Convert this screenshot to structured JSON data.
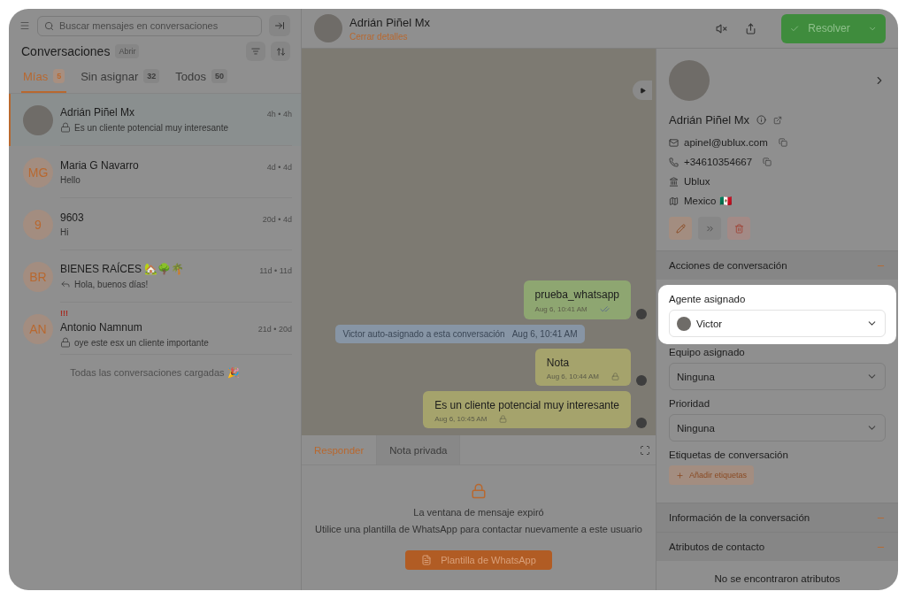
{
  "sidebar": {
    "search": {
      "placeholder": "Buscar mensajes en conversaciones"
    },
    "title": "Conversaciones",
    "status_badge": "Abrir",
    "tabs": [
      {
        "label": "Mías",
        "count": "5",
        "selected": true
      },
      {
        "label": "Sin asignar",
        "count": "32",
        "selected": false
      },
      {
        "label": "Todos",
        "count": "50",
        "selected": false
      }
    ],
    "conversations": [
      {
        "name": "Adrián Piñel Mx",
        "time": "4h • 4h",
        "preview": "Es un cliente potencial muy interesante",
        "private": true,
        "replied": false,
        "selected": true
      },
      {
        "name": "Maria G Navarro",
        "initials": "MG",
        "time": "4d • 4d",
        "preview": "Hello",
        "private": false,
        "replied": false,
        "selected": false
      },
      {
        "name": "9603",
        "initials": "9",
        "time": "20d • 4d",
        "preview": "Hi",
        "private": false,
        "replied": false,
        "selected": false
      },
      {
        "name": "BIENES RAÍCES 🏡🌳🌴",
        "initials": "BR",
        "time": "11d • 11d",
        "preview": "Hola, buenos días!",
        "private": false,
        "replied": true,
        "selected": false
      },
      {
        "name": "Antonio Namnum",
        "initials": "AN",
        "priority": "!!!",
        "time": "21d • 20d",
        "preview": "oye este esx un cliente importante",
        "private": true,
        "replied": false,
        "selected": false
      }
    ],
    "footer": "Todas las conversaciones cargadas 🎉"
  },
  "header": {
    "contact_name": "Adrián Piñel Mx",
    "details_link": "Cerrar detalles",
    "resolve_button": "Resolver"
  },
  "messages": [
    {
      "kind": "outgoing",
      "text": "prueba_whatsapp",
      "time": "Aug 6, 10:41 AM"
    },
    {
      "kind": "activity",
      "text": "Victor auto-asignado a esta conversación",
      "time": "Aug 6, 10:41 AM"
    },
    {
      "kind": "note",
      "text": "Nota",
      "time": "Aug 6, 10:44 AM"
    },
    {
      "kind": "note",
      "text": "Es un cliente potencial muy interesante",
      "time": "Aug 6, 10:45 AM"
    }
  ],
  "reply": {
    "tabs": [
      {
        "label": "Responder",
        "selected": true
      },
      {
        "label": "Nota privada",
        "selected": false
      }
    ],
    "expired_title": "La ventana de mensaje expiró",
    "expired_text": "Utilice una plantilla de WhatsApp para contactar nuevamente a este usuario",
    "template_button": "Plantilla de WhatsApp"
  },
  "contact": {
    "name": "Adrián Piñel Mx",
    "details": [
      {
        "kind": "email",
        "value": "apinel@ublux.com",
        "copyable": true
      },
      {
        "kind": "phone",
        "value": "+34610354667",
        "copyable": true
      },
      {
        "kind": "company",
        "value": "Ublux",
        "copyable": false
      },
      {
        "kind": "location",
        "value": "Mexico 🇲🇽",
        "copyable": false
      }
    ]
  },
  "actions_section": {
    "title": "Acciones de conversación",
    "expanded": true,
    "fields": [
      {
        "label": "Agente asignado",
        "value": "Victor",
        "avatar": true,
        "highlighted": true
      },
      {
        "label": "Equipo asignado",
        "value": "Ninguna",
        "avatar": false,
        "highlighted": false
      },
      {
        "label": "Prioridad",
        "value": "Ninguna",
        "avatar": false,
        "highlighted": false
      }
    ],
    "labels_title": "Etiquetas de conversación",
    "add_labels_button": "Añadir etiquetas"
  },
  "sections": [
    {
      "title": "Información de la conversación",
      "expanded": true
    },
    {
      "title": "Atributos de contacto",
      "expanded": true
    }
  ],
  "empty_attributes": "No se encontraron atributos"
}
